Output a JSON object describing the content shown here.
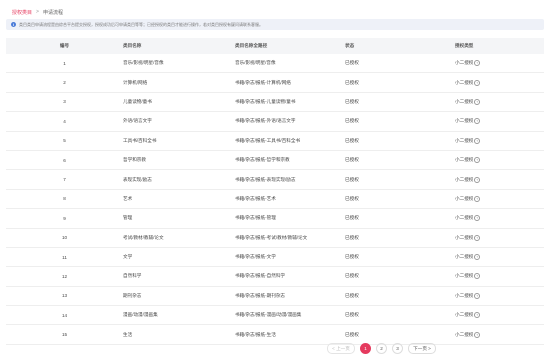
{
  "breadcrumb": {
    "link": "授权类目",
    "separator": ">",
    "current": "申请流程"
  },
  "notice": {
    "icon": "info-icon",
    "text": "类目类目申请流程是由综合平台提交授权，授权成功后可申请类目等等；已经授权的类目才能进行操作，若对类目授权有疑问请联系客服。"
  },
  "table": {
    "headers": [
      "编号",
      "类目名称",
      "类目名称全路径",
      "状态",
      "授权类型"
    ],
    "rows": [
      {
        "no": "1",
        "name": "音乐/影视/明星/音像",
        "path": "音乐/影视/明星/音像",
        "status": "已授权",
        "type": "小二授权"
      },
      {
        "no": "2",
        "name": "计算机/网络",
        "path": "书籍/杂志/报纸-计算机/网络",
        "status": "已授权",
        "type": "小二授权"
      },
      {
        "no": "3",
        "name": "儿童读物/童书",
        "path": "书籍/杂志/报纸-儿童读物/童书",
        "status": "已授权",
        "type": "小二授权"
      },
      {
        "no": "4",
        "name": "外语/语言文字",
        "path": "书籍/杂志/报纸-外语/语言文字",
        "status": "已授权",
        "type": "小二授权"
      },
      {
        "no": "5",
        "name": "工具书/百科全书",
        "path": "书籍/杂志/报纸-工具书/百科全书",
        "status": "已授权",
        "type": "小二授权"
      },
      {
        "no": "6",
        "name": "哲学和宗教",
        "path": "书籍/杂志/报纸-哲学和宗教",
        "status": "已授权",
        "type": "小二授权"
      },
      {
        "no": "7",
        "name": "表现实现/励志",
        "path": "书籍/杂志/报纸-表现实现/励志",
        "status": "已授权",
        "type": "小二授权"
      },
      {
        "no": "8",
        "name": "艺术",
        "path": "书籍/杂志/报纸-艺术",
        "status": "已授权",
        "type": "小二授权"
      },
      {
        "no": "9",
        "name": "管理",
        "path": "书籍/杂志/报纸-管理",
        "status": "已授权",
        "type": "小二授权"
      },
      {
        "no": "10",
        "name": "考试/教材/教辅/论文",
        "path": "书籍/杂志/报纸-考试/教材/教辅/论文",
        "status": "已授权",
        "type": "小二授权"
      },
      {
        "no": "11",
        "name": "文学",
        "path": "书籍/杂志/报纸-文学",
        "status": "已授权",
        "type": "小二授权"
      },
      {
        "no": "12",
        "name": "自然科学",
        "path": "书籍/杂志/报纸-自然科学",
        "status": "已授权",
        "type": "小二授权"
      },
      {
        "no": "13",
        "name": "期刊杂志",
        "path": "书籍/杂志/报纸-期刊杂志",
        "status": "已授权",
        "type": "小二授权"
      },
      {
        "no": "14",
        "name": "漫画/动漫/漫画集",
        "path": "书籍/杂志/报纸-漫画/动漫/漫画集",
        "status": "已授权",
        "type": "小二授权"
      },
      {
        "no": "15",
        "name": "生活",
        "path": "书籍/杂志/报纸-生活",
        "status": "已授权",
        "type": "小二授权"
      }
    ]
  },
  "pagination": {
    "prev": "< 上一页",
    "pages": [
      "1",
      "2",
      "3"
    ],
    "current": "1",
    "next": "下一页 >"
  },
  "colors": {
    "accent": "#e53a5e",
    "notice_bg": "#eef1f8",
    "header_bg": "#f4f5f7"
  }
}
